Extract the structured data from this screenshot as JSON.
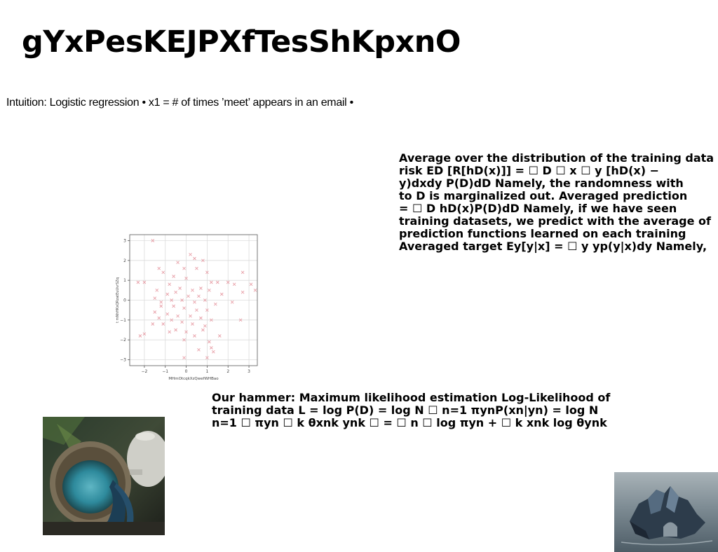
{
  "slide": {
    "title": "gYxPesKEJPXfTesShKpxnO",
    "intuition": "Intuition: Logistic regression • x1 = # of times ’meet’ appears in an email •",
    "right_block": [
      "Average over the distribution of the training data",
      "risk ED [R[hD(x)]] = ☐ D ☐ x ☐ y [hD(x) −",
      "y)dxdy P(D)dD Namely, the randomness with",
      "to D is marginalized out. Averaged prediction",
      "= ☐ D hD(x)P(D)dD Namely, if we have seen",
      "training datasets, we predict with the average of",
      "prediction functions learned on each training",
      "Averaged target Ey[y|x] = ☐ y yp(y|x)dy Namely,"
    ],
    "bottom_block": [
      "Our hammer: Maximum likelihood estimation Log-Likelihood of",
      "training data L = log P(D) = log N ☐ n=1 πynP(xn|yn) = log N",
      "n=1 ☐ πyn ☐ k θxnk ynk ☐ = ☐ n ☐ log πyn + ☐ k xnk log θynk"
    ]
  },
  "chart_data": {
    "type": "scatter",
    "xlabel": "MHmOtcqkXzQwefWHBao",
    "ylabel": "t mNhHKsQRzatEuUvrSZq",
    "xlim": [
      -2.7,
      3.4
    ],
    "ylim": [
      -3.3,
      3.3
    ],
    "xticks": [
      -2,
      -1,
      0,
      1,
      2,
      3
    ],
    "yticks": [
      -3,
      -2,
      -1,
      0,
      1,
      2,
      3
    ],
    "grid": true,
    "marker": "x",
    "color": "#e8a0a8",
    "points": [
      [
        -1.6,
        3.0
      ],
      [
        0.2,
        2.3
      ],
      [
        0.4,
        2.1
      ],
      [
        -0.4,
        1.9
      ],
      [
        0.8,
        2.0
      ],
      [
        0.5,
        1.6
      ],
      [
        -1.3,
        1.6
      ],
      [
        -1.1,
        1.4
      ],
      [
        -0.1,
        1.6
      ],
      [
        1.0,
        1.4
      ],
      [
        2.7,
        1.4
      ],
      [
        -2.3,
        0.9
      ],
      [
        -2.0,
        0.9
      ],
      [
        -0.6,
        1.2
      ],
      [
        0.0,
        1.1
      ],
      [
        1.2,
        0.9
      ],
      [
        1.5,
        0.9
      ],
      [
        2.0,
        0.9
      ],
      [
        2.3,
        0.8
      ],
      [
        3.1,
        0.8
      ],
      [
        -0.8,
        0.8
      ],
      [
        -0.3,
        0.6
      ],
      [
        0.3,
        0.5
      ],
      [
        0.7,
        0.6
      ],
      [
        1.1,
        0.5
      ],
      [
        -1.4,
        0.5
      ],
      [
        -0.9,
        0.3
      ],
      [
        -0.5,
        0.4
      ],
      [
        0.1,
        0.2
      ],
      [
        0.6,
        0.2
      ],
      [
        2.7,
        0.4
      ],
      [
        3.3,
        0.5
      ],
      [
        1.7,
        0.3
      ],
      [
        -1.5,
        0.1
      ],
      [
        -0.7,
        0.0
      ],
      [
        -0.2,
        0.0
      ],
      [
        0.4,
        -0.1
      ],
      [
        0.9,
        0.0
      ],
      [
        1.4,
        -0.2
      ],
      [
        -1.2,
        -0.3
      ],
      [
        -0.6,
        -0.3
      ],
      [
        -0.1,
        -0.4
      ],
      [
        0.5,
        -0.5
      ],
      [
        1.0,
        -0.5
      ],
      [
        -1.5,
        -0.6
      ],
      [
        -0.9,
        -0.7
      ],
      [
        -0.4,
        -0.8
      ],
      [
        0.2,
        -0.8
      ],
      [
        0.7,
        -0.9
      ],
      [
        1.2,
        -1.0
      ],
      [
        -1.3,
        -0.9
      ],
      [
        -0.7,
        -1.0
      ],
      [
        -0.2,
        -1.1
      ],
      [
        0.3,
        -1.2
      ],
      [
        0.9,
        -1.3
      ],
      [
        2.6,
        -1.0
      ],
      [
        -1.1,
        -1.2
      ],
      [
        -0.5,
        -1.5
      ],
      [
        0.0,
        -1.6
      ],
      [
        0.8,
        -1.5
      ],
      [
        1.6,
        -1.8
      ],
      [
        -2.0,
        -1.7
      ],
      [
        -2.2,
        -1.8
      ],
      [
        -0.8,
        -1.6
      ],
      [
        0.4,
        -1.8
      ],
      [
        -0.1,
        -2.0
      ],
      [
        1.1,
        -2.1
      ],
      [
        0.6,
        -2.5
      ],
      [
        1.3,
        -2.6
      ],
      [
        1.2,
        -2.4
      ],
      [
        -0.1,
        -2.9
      ],
      [
        1.0,
        -2.9
      ],
      [
        -1.6,
        -1.2
      ],
      [
        -1.2,
        -0.1
      ],
      [
        2.2,
        -0.1
      ]
    ]
  }
}
